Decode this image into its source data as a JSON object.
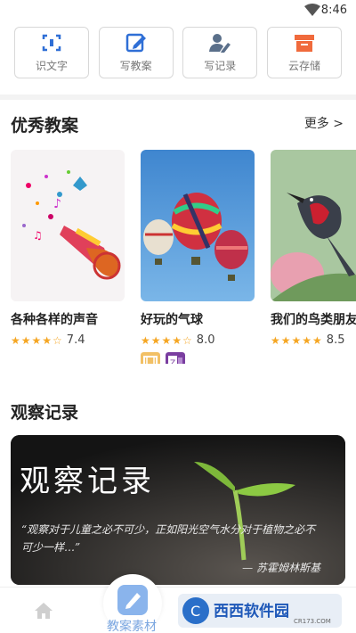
{
  "status": {
    "time": "8:46"
  },
  "tools": [
    {
      "label": "识文字",
      "icon": "scan-icon",
      "color": "#2f6fd6"
    },
    {
      "label": "写教案",
      "icon": "edit-icon",
      "color": "#2f6fd6"
    },
    {
      "label": "写记录",
      "icon": "user-edit-icon",
      "color": "#5a6f8a"
    },
    {
      "label": "云存储",
      "icon": "cloud-box-icon",
      "color": "#f06a3c"
    }
  ],
  "excellent": {
    "title": "优秀教案",
    "more": "更多 >",
    "cards": [
      {
        "name": "各种各样的声音",
        "stars": "★★★★☆",
        "score": "7.4"
      },
      {
        "name": "好玩的气球",
        "stars": "★★★★☆",
        "score": "8.0"
      },
      {
        "name": "我们的鸟类朋友",
        "stars": "★★★★★",
        "score": "8.5"
      }
    ]
  },
  "observation": {
    "title": "观察记录",
    "banner_title": "观察记录",
    "banner_quote": "“观察对于儿童之必不可少，正如阳光空气水分对于植物之必不可少一样…”",
    "banner_author": "— 苏霍姆林斯基"
  },
  "nav": {
    "center_label": "教案素材"
  },
  "watermark": {
    "brand": "西西软件园",
    "url": "CR173.COM"
  }
}
